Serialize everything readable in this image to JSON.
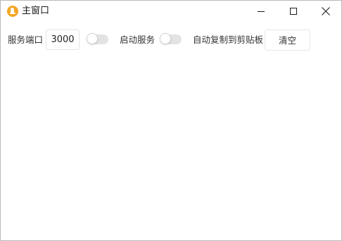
{
  "window": {
    "title": "主窗口",
    "app_icon": "bell-icon",
    "controls": {
      "minimize": "minimize-icon",
      "maximize": "maximize-icon",
      "close": "close-icon"
    }
  },
  "toolbar": {
    "port_label": "服务端口",
    "port_value": "3000",
    "port_toggle_on": false,
    "service_label": "启动服务",
    "service_toggle_on": false,
    "copy_label": "自动复制到剪贴板",
    "clear_label": "清空"
  },
  "colors": {
    "app_icon": "#f5a623",
    "toggle_off": "#e3e3e3"
  }
}
